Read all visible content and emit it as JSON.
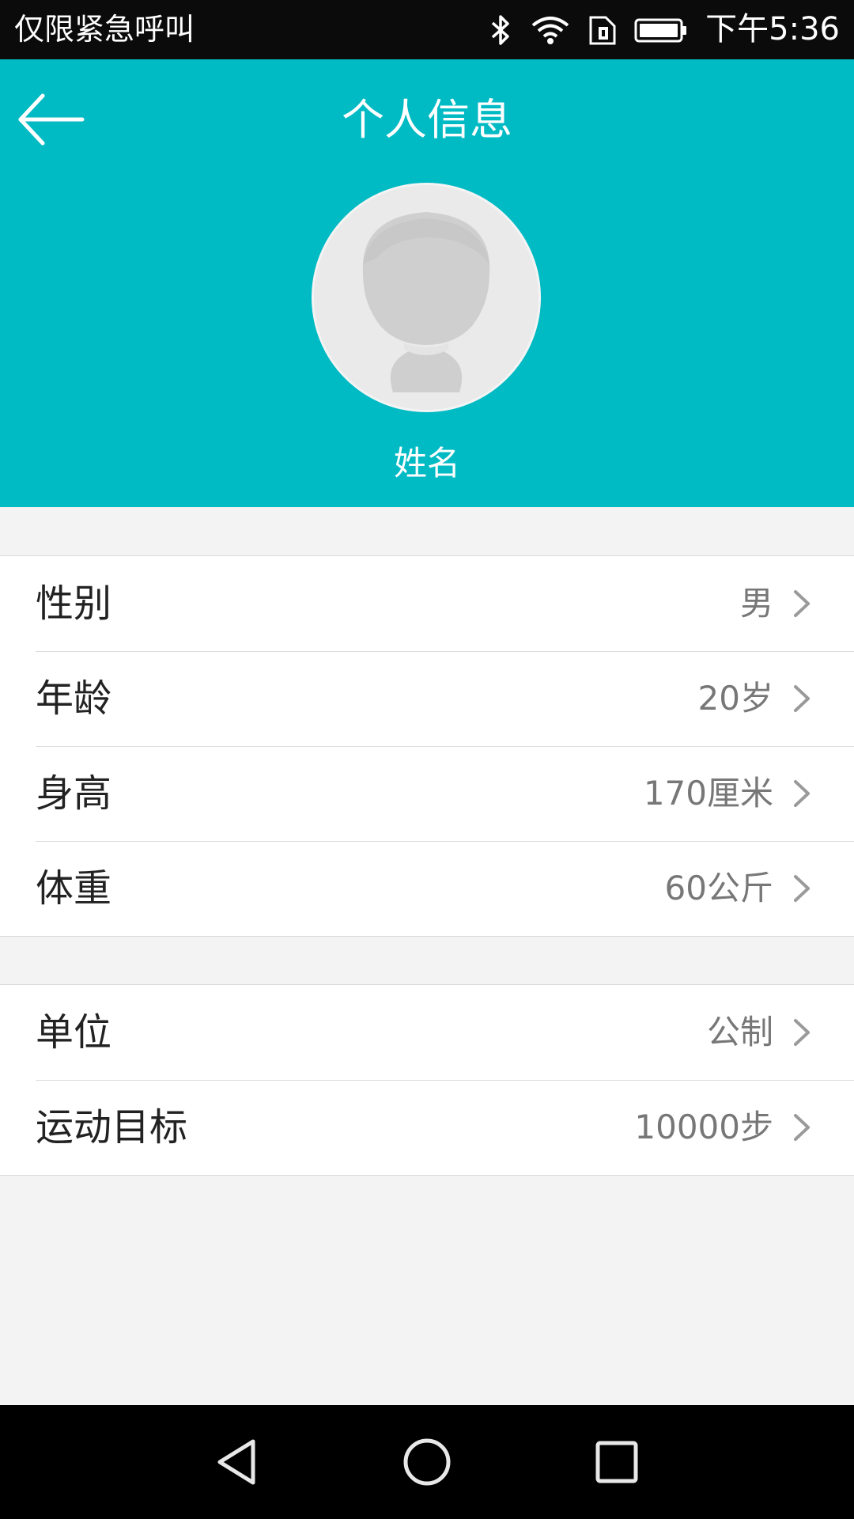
{
  "status_bar": {
    "left_text": "仅限紧急呼叫",
    "time": "下午5:36",
    "icons": [
      "bluetooth-icon",
      "wifi-icon",
      "sim-icon",
      "battery-icon"
    ]
  },
  "header": {
    "title": "个人信息",
    "back_icon": "arrow-left-icon",
    "avatar_icon": "default-avatar",
    "name": "姓名",
    "bg_color": "#00bac4"
  },
  "group1": [
    {
      "label": "性别",
      "value": "男"
    },
    {
      "label": "年龄",
      "value": "20岁"
    },
    {
      "label": "身高",
      "value": "170厘米"
    },
    {
      "label": "体重",
      "value": "60公斤"
    }
  ],
  "group2": [
    {
      "label": "单位",
      "value": "公制"
    },
    {
      "label": "运动目标",
      "value": "10000步"
    }
  ],
  "nav_bar": {
    "icons": [
      "nav-back-icon",
      "nav-home-icon",
      "nav-recents-icon"
    ]
  }
}
